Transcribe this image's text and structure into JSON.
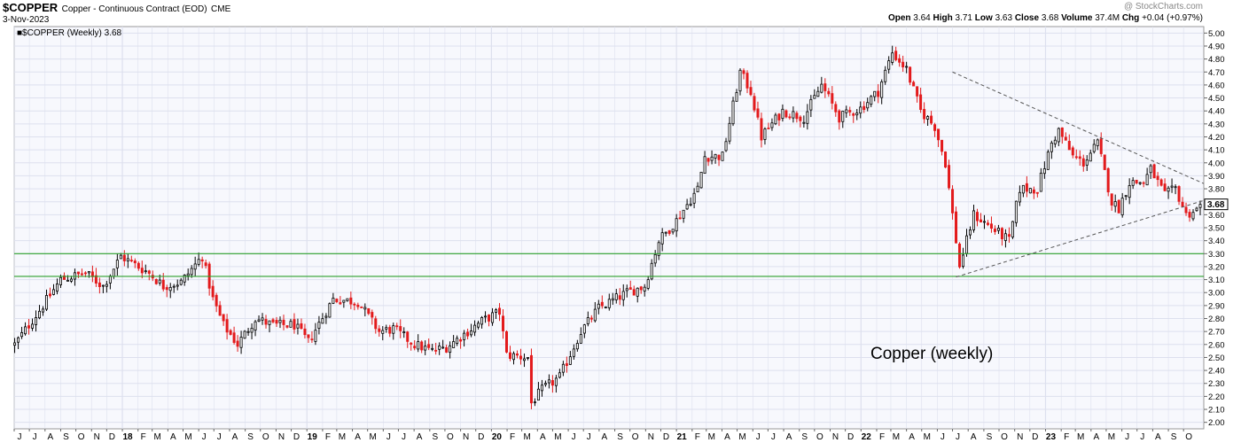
{
  "header": {
    "symbol": "$COPPER",
    "description": "Copper - Continuous Contract (EOD)",
    "exchange": "CME",
    "date": "3-Nov-2023",
    "brand": "@ StockCharts.com",
    "open_label": "Open",
    "open": "3.64",
    "high_label": "High",
    "high": "3.71",
    "low_label": "Low",
    "low": "3.63",
    "close_label": "Close",
    "close": "3.68",
    "volume_label": "Volume",
    "volume": "37.4M",
    "chg_label": "Chg",
    "chg": "+0.04 (+0.97%)"
  },
  "legend": {
    "text": "■$COPPER (Weekly) 3.68"
  },
  "annotation": "Copper (weekly)",
  "colors": {
    "up": "#000000",
    "down": "#e31a1c",
    "support": "#2ca02c",
    "trend": "#555555",
    "plot_bg": "#f7f8fd",
    "grid": "#dde0ee"
  },
  "chart_data": {
    "type": "candlestick",
    "title": "$COPPER (Weekly) 3.68",
    "ylim": [
      1.95,
      5.05
    ],
    "yticks": [
      2.0,
      2.1,
      2.2,
      2.3,
      2.4,
      2.5,
      2.6,
      2.7,
      2.8,
      2.9,
      3.0,
      3.1,
      3.2,
      3.3,
      3.4,
      3.5,
      3.6,
      3.7,
      3.8,
      3.9,
      4.0,
      4.1,
      4.2,
      4.3,
      4.4,
      4.5,
      4.6,
      4.7,
      4.8,
      4.9,
      5.0
    ],
    "ytick_labels": [
      "2.00",
      "2.10",
      "2.20",
      "2.30",
      "2.40",
      "2.50",
      "2.60",
      "2.70",
      "2.80",
      "2.90",
      "3.00",
      "3.10",
      "3.20",
      "3.30",
      "3.40",
      "3.50",
      "3.60",
      "3.70",
      "3.80",
      "3.90",
      "4.00",
      "4.10",
      "4.20",
      "4.30",
      "4.40",
      "4.50",
      "4.60",
      "4.70",
      "4.80",
      "4.90",
      "5.00"
    ],
    "last_value_label": "3.68",
    "last_value": 3.68,
    "xlim": [
      "2017-06-01",
      "2023-11-10"
    ],
    "x_ticks": [
      {
        "label": "J",
        "date": "2017-06-01",
        "bold": false
      },
      {
        "label": "J",
        "date": "2017-07-01",
        "bold": false
      },
      {
        "label": "A",
        "date": "2017-08-01",
        "bold": false
      },
      {
        "label": "S",
        "date": "2017-09-01",
        "bold": false
      },
      {
        "label": "O",
        "date": "2017-10-01",
        "bold": false
      },
      {
        "label": "N",
        "date": "2017-11-01",
        "bold": false
      },
      {
        "label": "D",
        "date": "2017-12-01",
        "bold": false
      },
      {
        "label": "18",
        "date": "2018-01-01",
        "bold": true
      },
      {
        "label": "F",
        "date": "2018-02-01",
        "bold": false
      },
      {
        "label": "M",
        "date": "2018-03-01",
        "bold": false
      },
      {
        "label": "A",
        "date": "2018-04-01",
        "bold": false
      },
      {
        "label": "M",
        "date": "2018-05-01",
        "bold": false
      },
      {
        "label": "J",
        "date": "2018-06-01",
        "bold": false
      },
      {
        "label": "J",
        "date": "2018-07-01",
        "bold": false
      },
      {
        "label": "A",
        "date": "2018-08-01",
        "bold": false
      },
      {
        "label": "S",
        "date": "2018-09-01",
        "bold": false
      },
      {
        "label": "O",
        "date": "2018-10-01",
        "bold": false
      },
      {
        "label": "N",
        "date": "2018-11-01",
        "bold": false
      },
      {
        "label": "D",
        "date": "2018-12-01",
        "bold": false
      },
      {
        "label": "19",
        "date": "2019-01-01",
        "bold": true
      },
      {
        "label": "F",
        "date": "2019-02-01",
        "bold": false
      },
      {
        "label": "M",
        "date": "2019-03-01",
        "bold": false
      },
      {
        "label": "A",
        "date": "2019-04-01",
        "bold": false
      },
      {
        "label": "M",
        "date": "2019-05-01",
        "bold": false
      },
      {
        "label": "J",
        "date": "2019-06-01",
        "bold": false
      },
      {
        "label": "J",
        "date": "2019-07-01",
        "bold": false
      },
      {
        "label": "A",
        "date": "2019-08-01",
        "bold": false
      },
      {
        "label": "S",
        "date": "2019-09-01",
        "bold": false
      },
      {
        "label": "O",
        "date": "2019-10-01",
        "bold": false
      },
      {
        "label": "N",
        "date": "2019-11-01",
        "bold": false
      },
      {
        "label": "D",
        "date": "2019-12-01",
        "bold": false
      },
      {
        "label": "20",
        "date": "2020-01-01",
        "bold": true
      },
      {
        "label": "F",
        "date": "2020-02-01",
        "bold": false
      },
      {
        "label": "M",
        "date": "2020-03-01",
        "bold": false
      },
      {
        "label": "A",
        "date": "2020-04-01",
        "bold": false
      },
      {
        "label": "M",
        "date": "2020-05-01",
        "bold": false
      },
      {
        "label": "J",
        "date": "2020-06-01",
        "bold": false
      },
      {
        "label": "J",
        "date": "2020-07-01",
        "bold": false
      },
      {
        "label": "A",
        "date": "2020-08-01",
        "bold": false
      },
      {
        "label": "S",
        "date": "2020-09-01",
        "bold": false
      },
      {
        "label": "O",
        "date": "2020-10-01",
        "bold": false
      },
      {
        "label": "N",
        "date": "2020-11-01",
        "bold": false
      },
      {
        "label": "D",
        "date": "2020-12-01",
        "bold": false
      },
      {
        "label": "21",
        "date": "2021-01-01",
        "bold": true
      },
      {
        "label": "F",
        "date": "2021-02-01",
        "bold": false
      },
      {
        "label": "M",
        "date": "2021-03-01",
        "bold": false
      },
      {
        "label": "A",
        "date": "2021-04-01",
        "bold": false
      },
      {
        "label": "M",
        "date": "2021-05-01",
        "bold": false
      },
      {
        "label": "J",
        "date": "2021-06-01",
        "bold": false
      },
      {
        "label": "J",
        "date": "2021-07-01",
        "bold": false
      },
      {
        "label": "A",
        "date": "2021-08-01",
        "bold": false
      },
      {
        "label": "S",
        "date": "2021-09-01",
        "bold": false
      },
      {
        "label": "O",
        "date": "2021-10-01",
        "bold": false
      },
      {
        "label": "N",
        "date": "2021-11-01",
        "bold": false
      },
      {
        "label": "D",
        "date": "2021-12-01",
        "bold": false
      },
      {
        "label": "22",
        "date": "2022-01-01",
        "bold": true
      },
      {
        "label": "F",
        "date": "2022-02-01",
        "bold": false
      },
      {
        "label": "M",
        "date": "2022-03-01",
        "bold": false
      },
      {
        "label": "A",
        "date": "2022-04-01",
        "bold": false
      },
      {
        "label": "M",
        "date": "2022-05-01",
        "bold": false
      },
      {
        "label": "J",
        "date": "2022-06-01",
        "bold": false
      },
      {
        "label": "J",
        "date": "2022-07-01",
        "bold": false
      },
      {
        "label": "A",
        "date": "2022-08-01",
        "bold": false
      },
      {
        "label": "S",
        "date": "2022-09-01",
        "bold": false
      },
      {
        "label": "O",
        "date": "2022-10-01",
        "bold": false
      },
      {
        "label": "N",
        "date": "2022-11-01",
        "bold": false
      },
      {
        "label": "D",
        "date": "2022-12-01",
        "bold": false
      },
      {
        "label": "23",
        "date": "2023-01-01",
        "bold": true
      },
      {
        "label": "F",
        "date": "2023-02-01",
        "bold": false
      },
      {
        "label": "M",
        "date": "2023-03-01",
        "bold": false
      },
      {
        "label": "A",
        "date": "2023-04-01",
        "bold": false
      },
      {
        "label": "M",
        "date": "2023-05-01",
        "bold": false
      },
      {
        "label": "J",
        "date": "2023-06-01",
        "bold": false
      },
      {
        "label": "J",
        "date": "2023-07-01",
        "bold": false
      },
      {
        "label": "A",
        "date": "2023-08-01",
        "bold": false
      },
      {
        "label": "S",
        "date": "2023-09-01",
        "bold": false
      },
      {
        "label": "O",
        "date": "2023-10-01",
        "bold": false
      }
    ],
    "support_lines": [
      3.3,
      3.125
    ],
    "trendlines": [
      {
        "name": "upper",
        "x0": "2022-07-01",
        "y0": 4.7,
        "x1": "2023-11-10",
        "y1": 3.84
      },
      {
        "name": "lower",
        "x0": "2022-07-08",
        "y0": 3.12,
        "x1": "2023-11-10",
        "y1": 3.71
      }
    ],
    "grid": true,
    "anchors": [
      [
        "2017-06-02",
        2.6
      ],
      [
        "2017-07-28",
        2.9
      ],
      [
        "2017-09-01",
        3.1
      ],
      [
        "2017-10-20",
        3.15
      ],
      [
        "2017-11-24",
        3.05
      ],
      [
        "2017-12-29",
        3.28
      ],
      [
        "2018-02-23",
        3.15
      ],
      [
        "2018-03-23",
        3.05
      ],
      [
        "2018-04-27",
        3.08
      ],
      [
        "2018-06-08",
        3.28
      ],
      [
        "2018-06-29",
        2.95
      ],
      [
        "2018-07-20",
        2.75
      ],
      [
        "2018-08-17",
        2.6
      ],
      [
        "2018-09-21",
        2.8
      ],
      [
        "2018-10-26",
        2.75
      ],
      [
        "2018-12-07",
        2.75
      ],
      [
        "2019-01-04",
        2.62
      ],
      [
        "2019-02-22",
        2.95
      ],
      [
        "2019-04-12",
        2.93
      ],
      [
        "2019-05-24",
        2.7
      ],
      [
        "2019-06-21",
        2.72
      ],
      [
        "2019-08-02",
        2.6
      ],
      [
        "2019-09-06",
        2.55
      ],
      [
        "2019-10-04",
        2.58
      ],
      [
        "2019-12-13",
        2.78
      ],
      [
        "2020-01-17",
        2.85
      ],
      [
        "2020-01-31",
        2.52
      ],
      [
        "2020-03-13",
        2.5
      ],
      [
        "2020-03-20",
        2.15
      ],
      [
        "2020-04-10",
        2.25
      ],
      [
        "2020-05-15",
        2.35
      ],
      [
        "2020-06-26",
        2.7
      ],
      [
        "2020-07-31",
        2.88
      ],
      [
        "2020-09-25",
        3.0
      ],
      [
        "2020-10-30",
        3.05
      ],
      [
        "2020-11-27",
        3.4
      ],
      [
        "2020-12-31",
        3.55
      ],
      [
        "2021-02-12",
        3.8
      ],
      [
        "2021-02-26",
        4.05
      ],
      [
        "2021-04-02",
        4.05
      ],
      [
        "2021-05-07",
        4.7
      ],
      [
        "2021-05-28",
        4.55
      ],
      [
        "2021-06-18",
        4.2
      ],
      [
        "2021-07-30",
        4.4
      ],
      [
        "2021-09-10",
        4.35
      ],
      [
        "2021-10-15",
        4.6
      ],
      [
        "2021-11-19",
        4.35
      ],
      [
        "2021-12-31",
        4.42
      ],
      [
        "2022-02-04",
        4.55
      ],
      [
        "2022-03-04",
        4.85
      ],
      [
        "2022-04-01",
        4.72
      ],
      [
        "2022-04-29",
        4.4
      ],
      [
        "2022-05-27",
        4.28
      ],
      [
        "2022-06-17",
        4.0
      ],
      [
        "2022-07-01",
        3.6
      ],
      [
        "2022-07-15",
        3.2
      ],
      [
        "2022-08-12",
        3.6
      ],
      [
        "2022-09-16",
        3.5
      ],
      [
        "2022-10-21",
        3.4
      ],
      [
        "2022-11-11",
        3.8
      ],
      [
        "2022-12-16",
        3.8
      ],
      [
        "2023-01-13",
        4.15
      ],
      [
        "2023-01-27",
        4.25
      ],
      [
        "2023-02-24",
        4.05
      ],
      [
        "2023-03-17",
        4.0
      ],
      [
        "2023-04-14",
        4.15
      ],
      [
        "2023-05-12",
        3.7
      ],
      [
        "2023-05-26",
        3.65
      ],
      [
        "2023-06-16",
        3.85
      ],
      [
        "2023-07-14",
        3.85
      ],
      [
        "2023-07-28",
        3.95
      ],
      [
        "2023-08-25",
        3.75
      ],
      [
        "2023-09-15",
        3.8
      ],
      [
        "2023-10-06",
        3.6
      ],
      [
        "2023-10-27",
        3.64
      ],
      [
        "2023-11-03",
        3.68
      ]
    ],
    "series_note": "weekly OHLC candles interpolated through anchor closes"
  }
}
